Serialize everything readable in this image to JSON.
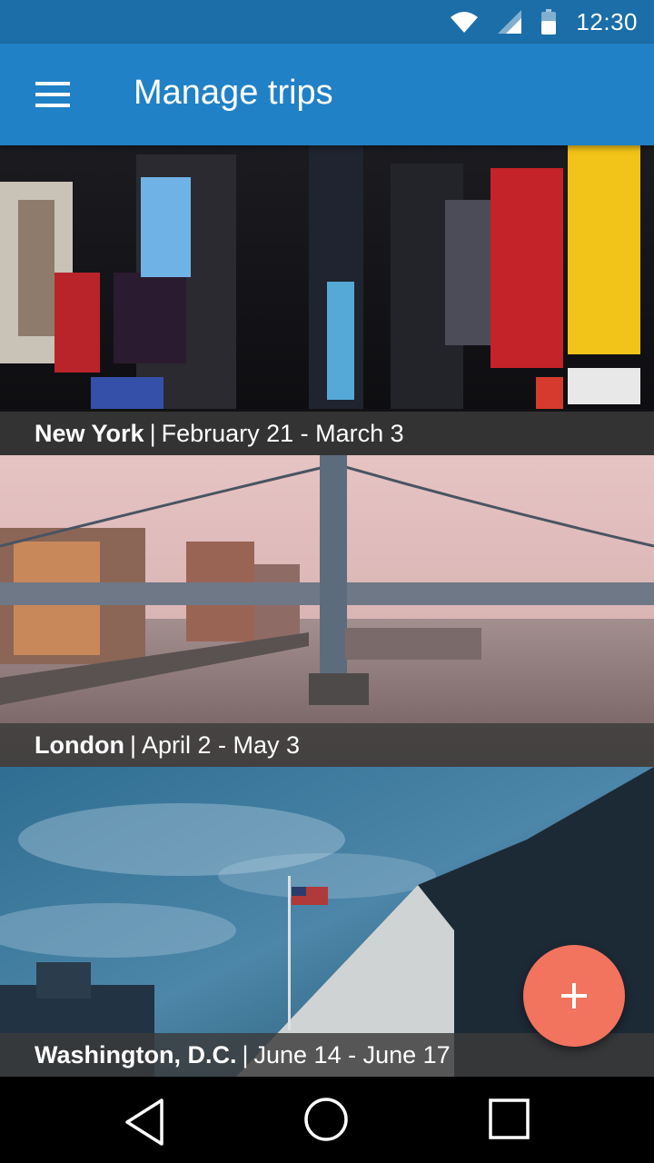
{
  "status_bar": {
    "time": "12:30",
    "icons": [
      "wifi-icon",
      "cell-signal-icon",
      "battery-icon"
    ]
  },
  "app_bar": {
    "title": "Manage trips",
    "menu_icon": "menu-icon",
    "color": "#2181c6"
  },
  "trips": [
    {
      "city": "New York",
      "separator": "|",
      "dates": "February 21 - March 3"
    },
    {
      "city": "London",
      "separator": "|",
      "dates": "April 2 - May 3"
    },
    {
      "city": "Washington, D.C.",
      "separator": "|",
      "dates": "June 14 - June 17"
    }
  ],
  "fab": {
    "icon": "plus-icon",
    "color": "#f2735e"
  },
  "nav_bar": {
    "icons": [
      "back-icon",
      "home-icon",
      "recents-icon"
    ]
  }
}
